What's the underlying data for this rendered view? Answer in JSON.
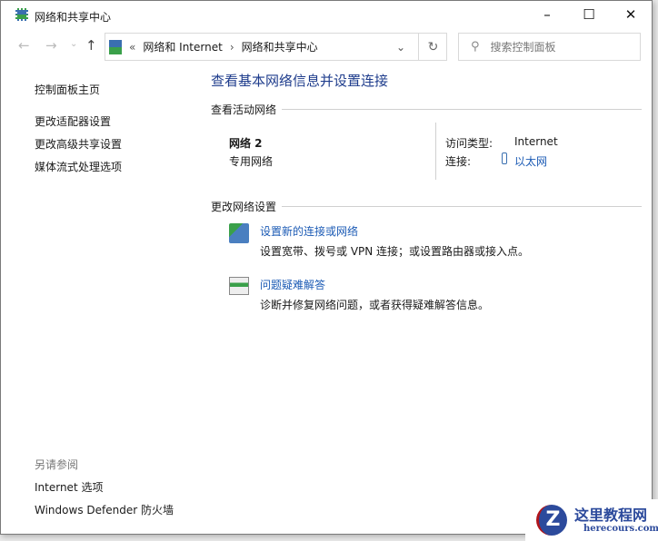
{
  "window": {
    "title": "网络和共享中心",
    "minimize": "–",
    "maximize": "☐",
    "close": "✕"
  },
  "nav": {
    "back": "←",
    "forward": "→",
    "recent": "⌄",
    "up": "↑",
    "breadcrumb_sep": "«",
    "crumbs": [
      "网络和 Internet",
      "网络和共享中心"
    ],
    "crumb_arrow": "›",
    "dropdown": "⌄",
    "refresh": "↻",
    "search_placeholder": "搜索控制面板"
  },
  "sidebar": {
    "home": "控制面板主页",
    "items": [
      "更改适配器设置",
      "更改高级共享设置",
      "媒体流式处理选项"
    ],
    "see_also": "另请参阅",
    "see_also_items": [
      "Internet 选项",
      "Windows Defender 防火墙"
    ]
  },
  "main": {
    "heading": "查看基本网络信息并设置连接",
    "active_header": "查看活动网络",
    "network_name": "网络 2",
    "network_type": "专用网络",
    "access_label": "访问类型:",
    "access_value": "Internet",
    "conn_label": "连接:",
    "conn_value": "以太网",
    "change_header": "更改网络设置",
    "tasks": [
      {
        "title": "设置新的连接或网络",
        "desc": "设置宽带、拨号或 VPN 连接；或设置路由器或接入点。"
      },
      {
        "title": "问题疑难解答",
        "desc": "诊断并修复网络问题，或者获得疑难解答信息。"
      }
    ]
  },
  "watermark": {
    "name": "这里教程网",
    "url": "herecours.com"
  }
}
